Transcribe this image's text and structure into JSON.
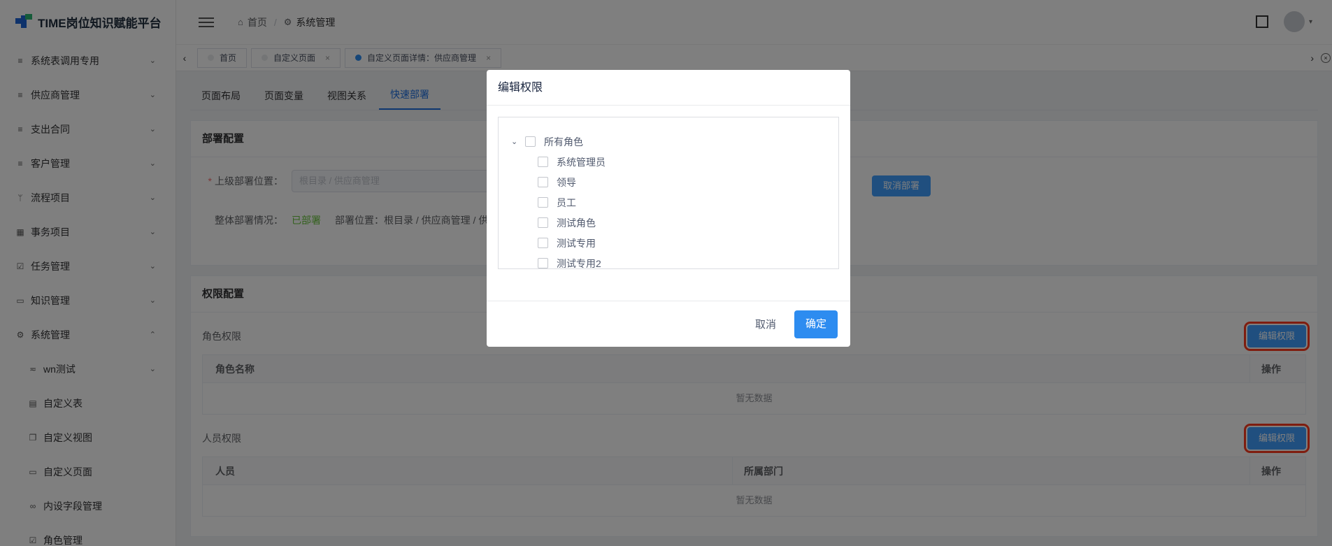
{
  "app": {
    "title": "TIME岗位知识赋能平台"
  },
  "sidebar": {
    "items": [
      {
        "label": "系统表调用专用",
        "icon": "menu-lines-icon",
        "chev": "⌄"
      },
      {
        "label": "供应商管理",
        "icon": "menu-lines-icon",
        "chev": "⌄"
      },
      {
        "label": "支出合同",
        "icon": "menu-lines-icon",
        "chev": "⌄"
      },
      {
        "label": "客户管理",
        "icon": "menu-lines-icon",
        "chev": "⌄"
      },
      {
        "label": "流程项目",
        "icon": "branch-icon",
        "chev": "⌄"
      },
      {
        "label": "事务项目",
        "icon": "grid-icon",
        "chev": "⌄"
      },
      {
        "label": "任务管理",
        "icon": "checkbox-icon",
        "chev": "⌄"
      },
      {
        "label": "知识管理",
        "icon": "book-icon",
        "chev": "⌄"
      },
      {
        "label": "系统管理",
        "icon": "gear-icon",
        "chev": "⌃"
      }
    ],
    "sub_items": [
      {
        "label": "wn测试",
        "icon": "filter-icon",
        "chev": "⌄"
      },
      {
        "label": "自定义表",
        "icon": "doc-icon",
        "chev": ""
      },
      {
        "label": "自定义视图",
        "icon": "copy-icon",
        "chev": ""
      },
      {
        "label": "自定义页面",
        "icon": "window-icon",
        "chev": ""
      },
      {
        "label": "内设字段管理",
        "icon": "link-icon",
        "chev": ""
      },
      {
        "label": "角色管理",
        "icon": "checkbox-icon",
        "chev": ""
      }
    ]
  },
  "header": {
    "breadcrumb": [
      "首页",
      "系统管理"
    ]
  },
  "tabs": [
    {
      "label": "首页",
      "closable": false,
      "active": false
    },
    {
      "label": "自定义页面",
      "closable": true,
      "active": false
    },
    {
      "label": "自定义页面详情：供应商管理",
      "closable": true,
      "active": true
    }
  ],
  "subtabs": [
    "页面布局",
    "页面变量",
    "视图关系",
    "快速部署"
  ],
  "deploy": {
    "title": "部署配置",
    "parent_label": "上级部署位置：",
    "parent_placeholder": "根目录 / 供应商管理",
    "cancel_deploy": "取消部署",
    "status_label": "整体部署情况：",
    "status_value": "已部署",
    "location_text": "部署位置：根目录 / 供应商管理 / 供"
  },
  "permissions": {
    "title": "权限配置",
    "role_label": "角色权限",
    "edit_label": "编辑权限",
    "role_cols": [
      "角色名称",
      "操作"
    ],
    "empty_text": "暂无数据",
    "person_label": "人员权限",
    "person_cols": [
      "人员",
      "所属部门",
      "操作"
    ]
  },
  "modal": {
    "title": "编辑权限",
    "root": "所有角色",
    "roles": [
      "系统管理员",
      "领导",
      "员工",
      "测试角色",
      "测试专用",
      "测试专用2"
    ],
    "cancel": "取消",
    "confirm": "确定"
  },
  "colors": {
    "primary": "#2d8cf0",
    "highlight": "#ff3b1f",
    "success": "#67c23a"
  }
}
